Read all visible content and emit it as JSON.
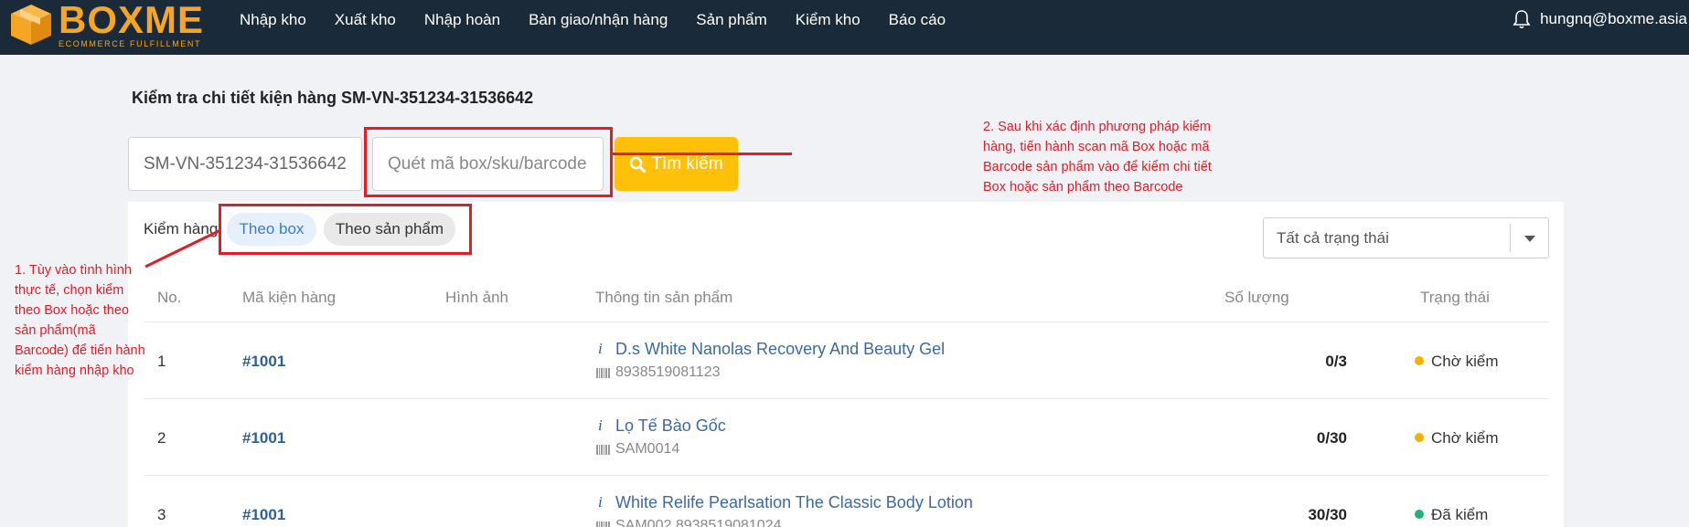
{
  "header": {
    "logo_name": "BOXME",
    "logo_tagline": "ECOMMERCE FULFILLMENT",
    "nav": [
      {
        "label": "Nhập kho"
      },
      {
        "label": "Xuất kho"
      },
      {
        "label": "Nhập hoàn"
      },
      {
        "label": "Bàn giao/nhận hàng"
      },
      {
        "label": "Sản phẩm"
      },
      {
        "label": "Kiểm kho"
      },
      {
        "label": "Báo cáo"
      }
    ],
    "user_email": "hungnq@boxme.asia"
  },
  "page": {
    "title": "Kiểm tra chi tiết kiện hàng SM-VN-351234-31536642"
  },
  "search": {
    "code_value": "SM-VN-351234-31536642",
    "scan_placeholder": "Quét mã box/sku/barcode",
    "button_label": "Tìm kiếm"
  },
  "filters": {
    "check_label": "Kiểm hàng",
    "by_box": "Theo box",
    "by_product": "Theo sản phẩm",
    "status_select": "Tất cả trạng thái"
  },
  "table": {
    "columns": [
      "No.",
      "Mã kiện hàng",
      "Hình ảnh",
      "Thông tin sản phẩm",
      "Số lượng",
      "Trạng thái"
    ],
    "rows": [
      {
        "no": "1",
        "box_code": "#1001",
        "product_name": "D.s White Nanolas Recovery And Beauty Gel",
        "barcode": "8938519081123",
        "quantity": "0/3",
        "status": "Chờ kiểm",
        "status_color": "#f6b100"
      },
      {
        "no": "2",
        "box_code": "#1001",
        "product_name": "Lọ Tế Bào Gốc",
        "barcode": "SAM0014",
        "quantity": "0/30",
        "status": "Chờ kiểm",
        "status_color": "#f6b100"
      },
      {
        "no": "3",
        "box_code": "#1001",
        "product_name": "White Relife Pearlsation The Classic Body Lotion",
        "barcode": "SAM002,8938519081024",
        "quantity": "30/30",
        "status": "Đã kiểm",
        "status_color": "#1fb37a"
      }
    ]
  },
  "annotations": {
    "note1": "1. Tùy vào tình hình thực tế, chọn kiểm theo Box hoặc theo sản phẩm(mã Barcode) để tiến hành kiểm hàng nhập kho",
    "note2": "2. Sau khi xác định phương pháp kiểm hàng, tiến hành scan mã Box hoặc mã Barcode sản phẩm vào để kiểm chi tiết Box hoặc sản phẩm theo Barcode",
    "color": "#e11d28"
  },
  "colors": {
    "topbar": "#1b2a38",
    "brand": "#f6a623",
    "search_button": "#fec107",
    "link": "#2c5f94"
  }
}
